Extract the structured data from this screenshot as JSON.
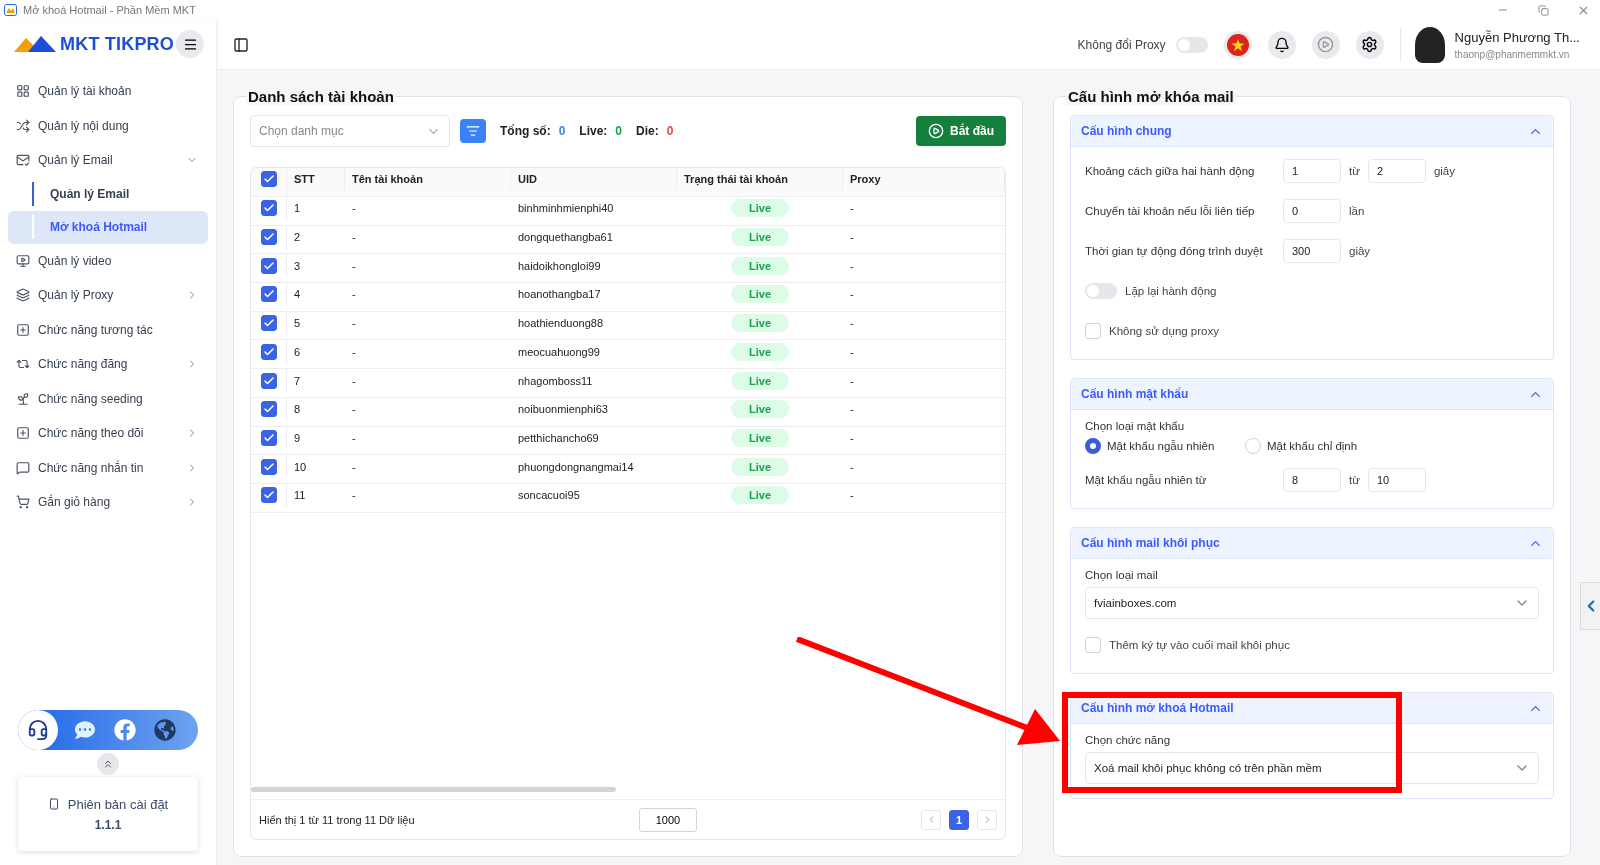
{
  "window": {
    "title": "Mở khoá Hotmail - Phần Mềm MKT"
  },
  "brand": {
    "name": "MKT TIKPRO"
  },
  "sidebar": {
    "items": [
      {
        "label": "Quản lý tài khoản",
        "kind": "link"
      },
      {
        "label": "Quản lý nội dung",
        "kind": "link"
      },
      {
        "label": "Quản lý Email",
        "kind": "group",
        "expanded": true,
        "children": [
          {
            "label": "Quản lý Email",
            "selected": false
          },
          {
            "label": "Mở khoá Hotmail",
            "selected": true
          }
        ]
      },
      {
        "label": "Quản lý video",
        "kind": "link"
      },
      {
        "label": "Quản lý Proxy",
        "kind": "group",
        "expanded": false
      },
      {
        "label": "Chức năng tương tác",
        "kind": "link"
      },
      {
        "label": "Chức năng đăng",
        "kind": "group",
        "expanded": false
      },
      {
        "label": "Chức năng seeding",
        "kind": "link"
      },
      {
        "label": "Chức năng theo dõi",
        "kind": "group",
        "expanded": false
      },
      {
        "label": "Chức năng nhắn tin",
        "kind": "group",
        "expanded": false
      },
      {
        "label": "Gắn giỏ hàng",
        "kind": "group",
        "expanded": false
      }
    ],
    "version": {
      "label": "Phiên bản cài đặt",
      "value": "1.1.1"
    }
  },
  "topbar": {
    "proxy_toggle": {
      "label": "Không đổi Proxy",
      "on": false
    },
    "user": {
      "name": "Nguyễn Phương Th...",
      "email": "thaonp@phanmemmkt.vn"
    }
  },
  "accounts": {
    "title": "Danh sách tài khoản",
    "category_select": {
      "placeholder": "Chọn danh mục"
    },
    "stats": [
      {
        "label": "Tổng số:",
        "value": "0",
        "color": "#3b82f6"
      },
      {
        "label": "Live:",
        "value": "0",
        "color": "#16a34a"
      },
      {
        "label": "Die:",
        "value": "0",
        "color": "#ef4444"
      }
    ],
    "start_button": "Bắt đầu",
    "table": {
      "all_checked": true,
      "columns": [
        "STT",
        "Tên tài khoản",
        "UID",
        "Trạng thái tài khoản",
        "Proxy"
      ],
      "rows": [
        {
          "checked": true,
          "stt": "1",
          "name": "-",
          "uid": "binhminhmienphi40",
          "status": "Live",
          "proxy": "-"
        },
        {
          "checked": true,
          "stt": "2",
          "name": "-",
          "uid": "dongquethangba61",
          "status": "Live",
          "proxy": "-"
        },
        {
          "checked": true,
          "stt": "3",
          "name": "-",
          "uid": "haidoikhongloi99",
          "status": "Live",
          "proxy": "-"
        },
        {
          "checked": true,
          "stt": "4",
          "name": "-",
          "uid": "hoanothangba17",
          "status": "Live",
          "proxy": "-"
        },
        {
          "checked": true,
          "stt": "5",
          "name": "-",
          "uid": "hoathienduong88",
          "status": "Live",
          "proxy": "-"
        },
        {
          "checked": true,
          "stt": "6",
          "name": "-",
          "uid": "meocuahuong99",
          "status": "Live",
          "proxy": "-"
        },
        {
          "checked": true,
          "stt": "7",
          "name": "-",
          "uid": "nhagomboss11",
          "status": "Live",
          "proxy": "-"
        },
        {
          "checked": true,
          "stt": "8",
          "name": "-",
          "uid": "noibuonmienphi63",
          "status": "Live",
          "proxy": "-"
        },
        {
          "checked": true,
          "stt": "9",
          "name": "-",
          "uid": "petthichancho69",
          "status": "Live",
          "proxy": "-"
        },
        {
          "checked": true,
          "stt": "10",
          "name": "-",
          "uid": "phuongdongnangmai14",
          "status": "Live",
          "proxy": "-"
        },
        {
          "checked": true,
          "stt": "11",
          "name": "-",
          "uid": "soncacuoi95",
          "status": "Live",
          "proxy": "-"
        }
      ]
    },
    "footer": {
      "summary": "Hiển thị 1 từ 11 trong 11 Dữ liệu",
      "page_size": "1000",
      "pages": [
        {
          "label": "1",
          "selected": true
        }
      ]
    }
  },
  "config": {
    "title": "Cấu hình mở khóa mail",
    "sections": [
      {
        "title": "Cấu hình chung",
        "expanded": true,
        "rows": [
          {
            "kind": "range",
            "label": "Khoảng cách giữa hai hành động",
            "from": "1",
            "separator": "từ",
            "to": "2",
            "unit": "giây"
          },
          {
            "kind": "number",
            "label": "Chuyển tài khoản nếu lỗi liên tiếp",
            "value": "0",
            "unit": "lần"
          },
          {
            "kind": "number",
            "label": "Thời gian tự động đóng trình duyệt",
            "value": "300",
            "unit": "giây"
          },
          {
            "kind": "switch",
            "label": "Lặp lại hành động",
            "on": false
          },
          {
            "kind": "checkbox",
            "label": "Không sử dụng proxy",
            "checked": false
          }
        ]
      },
      {
        "title": "Cấu hình mật khẩu",
        "expanded": true,
        "rows": [
          {
            "kind": "radio",
            "label": "Chọn loại mật khẩu",
            "options": [
              {
                "label": "Mật khẩu ngẫu nhiên",
                "selected": true
              },
              {
                "label": "Mật khẩu chỉ định",
                "selected": false
              }
            ]
          },
          {
            "kind": "range",
            "label": "Mật khẩu ngẫu nhiên từ",
            "from": "8",
            "separator": "từ",
            "to": "10"
          }
        ]
      },
      {
        "title": "Cấu hình mail khôi phục",
        "expanded": true,
        "rows": [
          {
            "kind": "select",
            "label": "Chọn loại mail",
            "value": "fviainboxes.com"
          },
          {
            "kind": "checkbox",
            "label": "Thêm ký tự vào cuối mail khôi phục",
            "checked": false
          }
        ]
      },
      {
        "title": "Cấu hình mở khoá Hotmail",
        "expanded": true,
        "rows": [
          {
            "kind": "select",
            "label": "Chọn chức năng",
            "value": "Xoá mail khôi phục không có trên phần mềm"
          }
        ]
      }
    ]
  },
  "annotations": [
    {
      "kind": "arrow"
    },
    {
      "kind": "frame"
    }
  ]
}
